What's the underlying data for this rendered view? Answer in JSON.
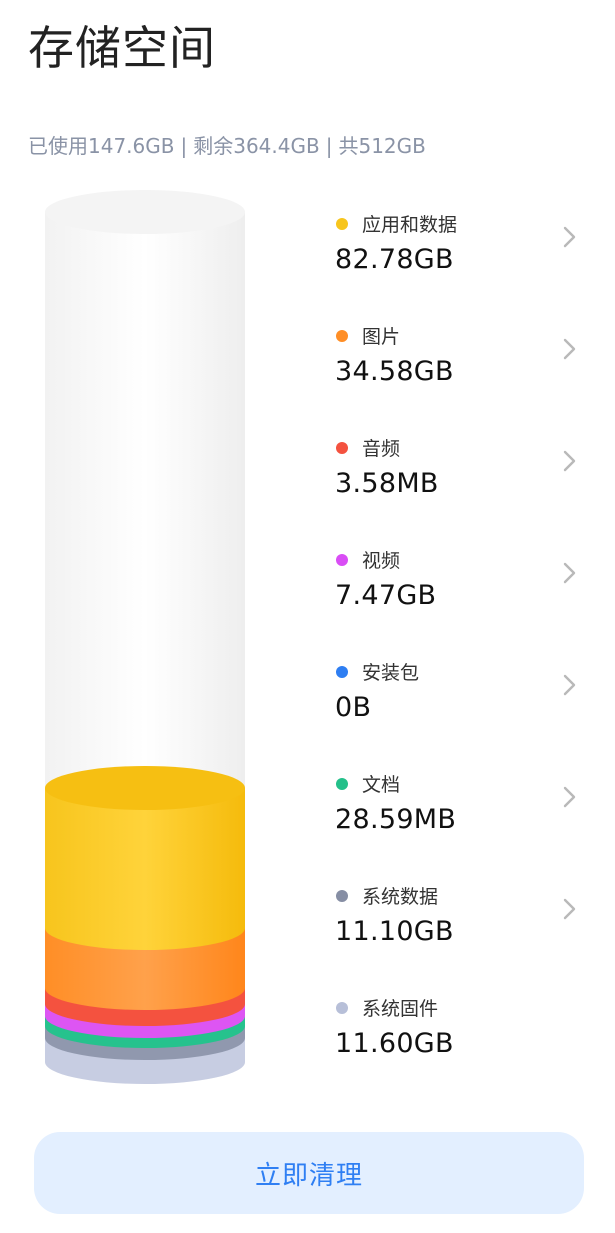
{
  "header": {
    "title": "存储空间"
  },
  "summary": {
    "used": "已使用147.6GB",
    "remaining": "剩余364.4GB",
    "total": "共512GB",
    "separator": "|"
  },
  "categories": [
    {
      "label": "应用和数据",
      "size": "82.78GB",
      "color": "#f7c51d",
      "icon": "chevron-right-icon"
    },
    {
      "label": "图片",
      "size": "34.58GB",
      "color": "#ff8e26",
      "icon": "chevron-right-icon"
    },
    {
      "label": "音频",
      "size": "3.58MB",
      "color": "#f4523f",
      "icon": "chevron-right-icon"
    },
    {
      "label": "视频",
      "size": "7.47GB",
      "color": "#d94df5",
      "icon": "chevron-right-icon"
    },
    {
      "label": "安装包",
      "size": "0B",
      "color": "#2e7ef2",
      "icon": "chevron-right-icon"
    },
    {
      "label": "文档",
      "size": "28.59MB",
      "color": "#24c08a",
      "icon": "chevron-right-icon"
    },
    {
      "label": "系统数据",
      "size": "11.10GB",
      "color": "#868ea4",
      "icon": "chevron-right-icon"
    },
    {
      "label": "系统固件",
      "size": "11.60GB",
      "color": "#b7bfd8"
    }
  ],
  "actions": {
    "clean_label": "立即清理"
  }
}
